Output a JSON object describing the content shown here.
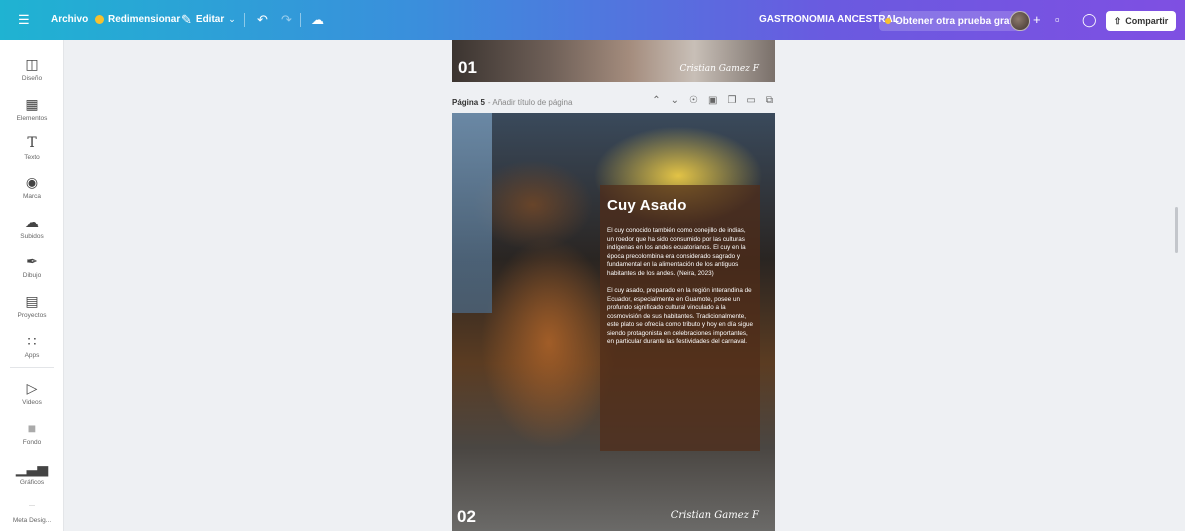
{
  "topbar": {
    "menu_icon": "hamburger-icon",
    "file": "Archivo",
    "resize": "Redimensionar",
    "edit": "Editar",
    "project_name": "GASTRONOMIA ANCESTRAL",
    "try_free": "Obtener otra prueba gratis",
    "share": "Compartir"
  },
  "sidebar": {
    "items": [
      {
        "label": "Diseño",
        "icon": "layout-icon"
      },
      {
        "label": "Elementos",
        "icon": "shapes-icon"
      },
      {
        "label": "Texto",
        "icon": "text-icon"
      },
      {
        "label": "Marca",
        "icon": "brand-icon"
      },
      {
        "label": "Subidos",
        "icon": "upload-cloud-icon"
      },
      {
        "label": "Dibujo",
        "icon": "pen-icon"
      },
      {
        "label": "Proyectos",
        "icon": "folder-icon"
      },
      {
        "label": "Apps",
        "icon": "apps-icon"
      },
      {
        "label": "Videos",
        "icon": "video-icon"
      },
      {
        "label": "Fondo",
        "icon": "background-icon"
      },
      {
        "label": "Gráficos",
        "icon": "chart-icon"
      },
      {
        "label": "Meta Desig...",
        "icon": "app-icon"
      }
    ]
  },
  "prev_page": {
    "number": "01",
    "signature": "Cristian Gamez F"
  },
  "page": {
    "label": "Página 5",
    "add_title": "- Añadir título de página",
    "number": "02",
    "signature": "Cristian Gamez F",
    "title": "Cuy Asado",
    "paragraph1": "El cuy conocido también como conejillo de indias, un roedor que ha sido consumido por las culturas indígenas en los andes ecuatorianos. El cuy en la época precolombina era considerado sagrado y fundamental en la alimentación de los antiguos habitantes de los andes. (Neira, 2023)",
    "paragraph2": "El cuy asado, preparado en la región interandina de Ecuador, especialmente en Guamote, posee un profundo significado cultural vinculado a la cosmovisión de sus habitantes. Tradicionalmente, este plato se ofrecía como tributo y hoy en día sigue siendo protagonista en celebraciones importantes, en particular durante las festividades del carnaval."
  },
  "colors": {
    "topbar_start": "#1fb3d2",
    "topbar_end": "#7f4fe2",
    "resize_badge": "#f7c12f",
    "card_bg": "#502d19"
  }
}
